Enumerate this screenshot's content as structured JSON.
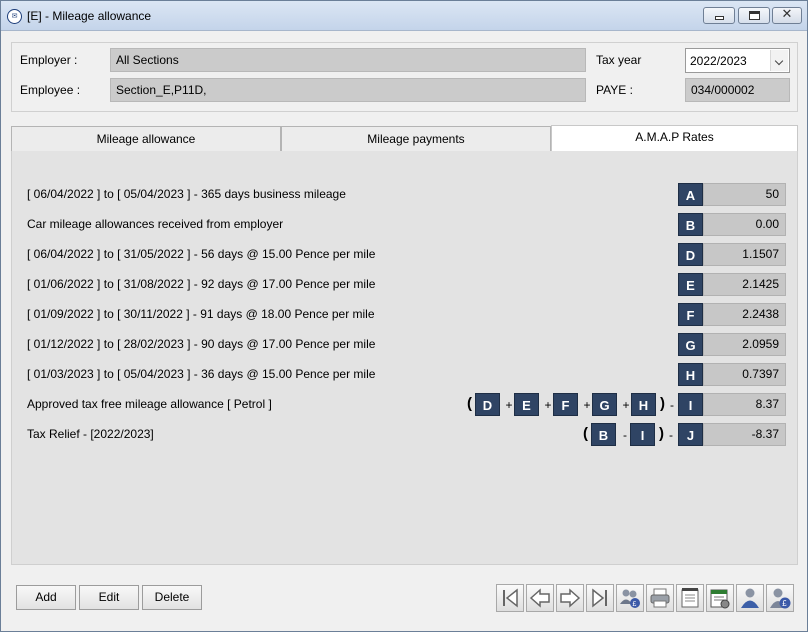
{
  "window": {
    "title": "[E] - Mileage allowance",
    "icon": "app-logo-icon"
  },
  "header": {
    "employer_label": "Employer :",
    "employer_value": "All Sections",
    "employee_label": "Employee :",
    "employee_value": "Section_E,P11D,",
    "taxyear_label": "Tax year",
    "taxyear_value": "2022/2023",
    "paye_label": "PAYE :",
    "paye_value": "034/000002"
  },
  "tabs": [
    {
      "label": "Mileage allowance"
    },
    {
      "label": "Mileage payments"
    },
    {
      "label": "A.M.A.P Rates",
      "active": true
    }
  ],
  "rows": [
    {
      "label": "[ 06/04/2022 ] to [ 05/04/2023 ] - 365 days business mileage",
      "letter": "A",
      "value": "50"
    },
    {
      "label": "Car mileage allowances received from employer",
      "letter": "B",
      "value": "0.00"
    },
    {
      "label": "[ 06/04/2022 ] to [ 31/05/2022 ] - 56 days @ 15.00 Pence per mile",
      "letter": "D",
      "value": "1.1507"
    },
    {
      "label": "[ 01/06/2022 ] to [ 31/08/2022 ] - 92 days @ 17.00 Pence per mile",
      "letter": "E",
      "value": "2.1425"
    },
    {
      "label": "[ 01/09/2022 ] to [ 30/11/2022 ] - 91 days @ 18.00 Pence per mile",
      "letter": "F",
      "value": "2.2438"
    },
    {
      "label": "[ 01/12/2022 ] to [ 28/02/2023 ] - 90 days @ 17.00 Pence per mile",
      "letter": "G",
      "value": "2.0959"
    },
    {
      "label": "[ 01/03/2023 ] to [ 05/04/2023 ] - 36 days @ 15.00 Pence per mile",
      "letter": "H",
      "value": "0.7397"
    },
    {
      "label": "Approved tax free mileage allowance [ Petrol ]",
      "letter": "I",
      "value": "8.37"
    },
    {
      "label": "Tax Relief - [2022/2023]",
      "letter": "J",
      "value": "-8.37"
    }
  ],
  "formula_i": {
    "open": "(",
    "close": ")",
    "letters": [
      "D",
      "E",
      "F",
      "G",
      "H"
    ],
    "ops": [
      "+",
      "+",
      "+",
      "+"
    ],
    "tail": "-"
  },
  "formula_j": {
    "open": "(",
    "close": ")",
    "letters": [
      "B",
      "I"
    ],
    "ops": [
      "-"
    ],
    "tail": "-"
  },
  "buttons": {
    "add": "Add",
    "edit": "Edit",
    "delete": "Delete"
  },
  "toolbar": [
    "first-record-icon",
    "previous-record-icon",
    "next-record-icon",
    "last-record-icon",
    "employees-payments-icon",
    "print-icon",
    "notes-icon",
    "report-settings-icon",
    "employee-icon",
    "employee-pay-icon"
  ],
  "colors": {
    "letter_bg": "#2f4464",
    "value_bg": "#c7c7c7",
    "content_bg": "#e3e3e3"
  }
}
